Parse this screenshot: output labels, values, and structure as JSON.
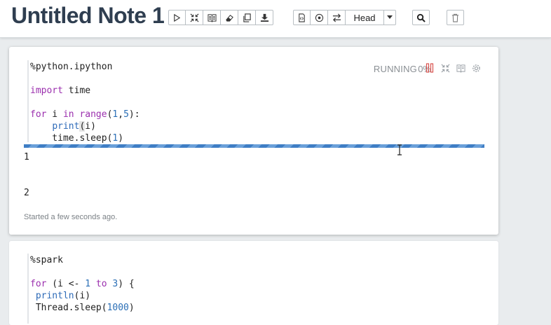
{
  "note": {
    "title": "Untitled Note 1"
  },
  "toolbar": {
    "interpreter_select": "Head"
  },
  "paragraph1": {
    "code_lines": [
      "%python.ipython",
      "",
      "import time",
      "",
      "for i in range(1,5):",
      "    print(i)",
      "    time.sleep(1)"
    ],
    "status": "RUNNING",
    "progress_text": "0%",
    "progress_value": 0,
    "output_lines": [
      "1",
      "2"
    ],
    "started_text": "Started a few seconds ago."
  },
  "paragraph2": {
    "code_lines": [
      "%spark",
      "",
      "for (i <- 1 to 3) {",
      " println(i)",
      " Thread.sleep(1000)"
    ]
  },
  "colors": {
    "title": "#2f3e50",
    "keyword": "#9b2fae",
    "number": "#2b6fb6",
    "progress_bar": "#3f7ec5",
    "pause_icon": "#d9534f"
  }
}
